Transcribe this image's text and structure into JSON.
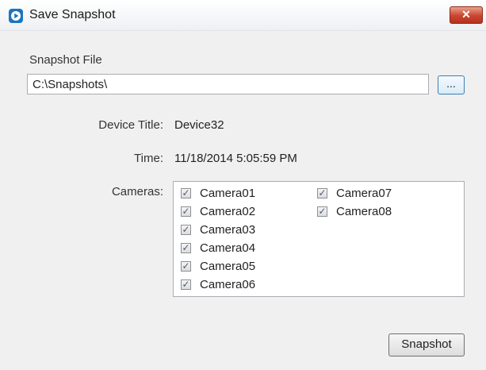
{
  "window": {
    "title": "Save Snapshot",
    "close_glyph": "✕",
    "icon": "app-play-icon",
    "accent": "#1e73be"
  },
  "snapshot_file": {
    "label": "Snapshot File",
    "value": "C:\\Snapshots\\",
    "browse_label": "..."
  },
  "device": {
    "label": "Device Title:",
    "value": "Device32"
  },
  "time": {
    "label": "Time:",
    "value": "11/18/2014 5:05:59 PM"
  },
  "cameras": {
    "label": "Cameras:",
    "check_glyph": "✓",
    "items": [
      {
        "name": "Camera01",
        "checked": true
      },
      {
        "name": "Camera02",
        "checked": true
      },
      {
        "name": "Camera03",
        "checked": true
      },
      {
        "name": "Camera04",
        "checked": true
      },
      {
        "name": "Camera05",
        "checked": true
      },
      {
        "name": "Camera06",
        "checked": true
      },
      {
        "name": "Camera07",
        "checked": true
      },
      {
        "name": "Camera08",
        "checked": true
      }
    ]
  },
  "actions": {
    "snapshot_label": "Snapshot"
  }
}
